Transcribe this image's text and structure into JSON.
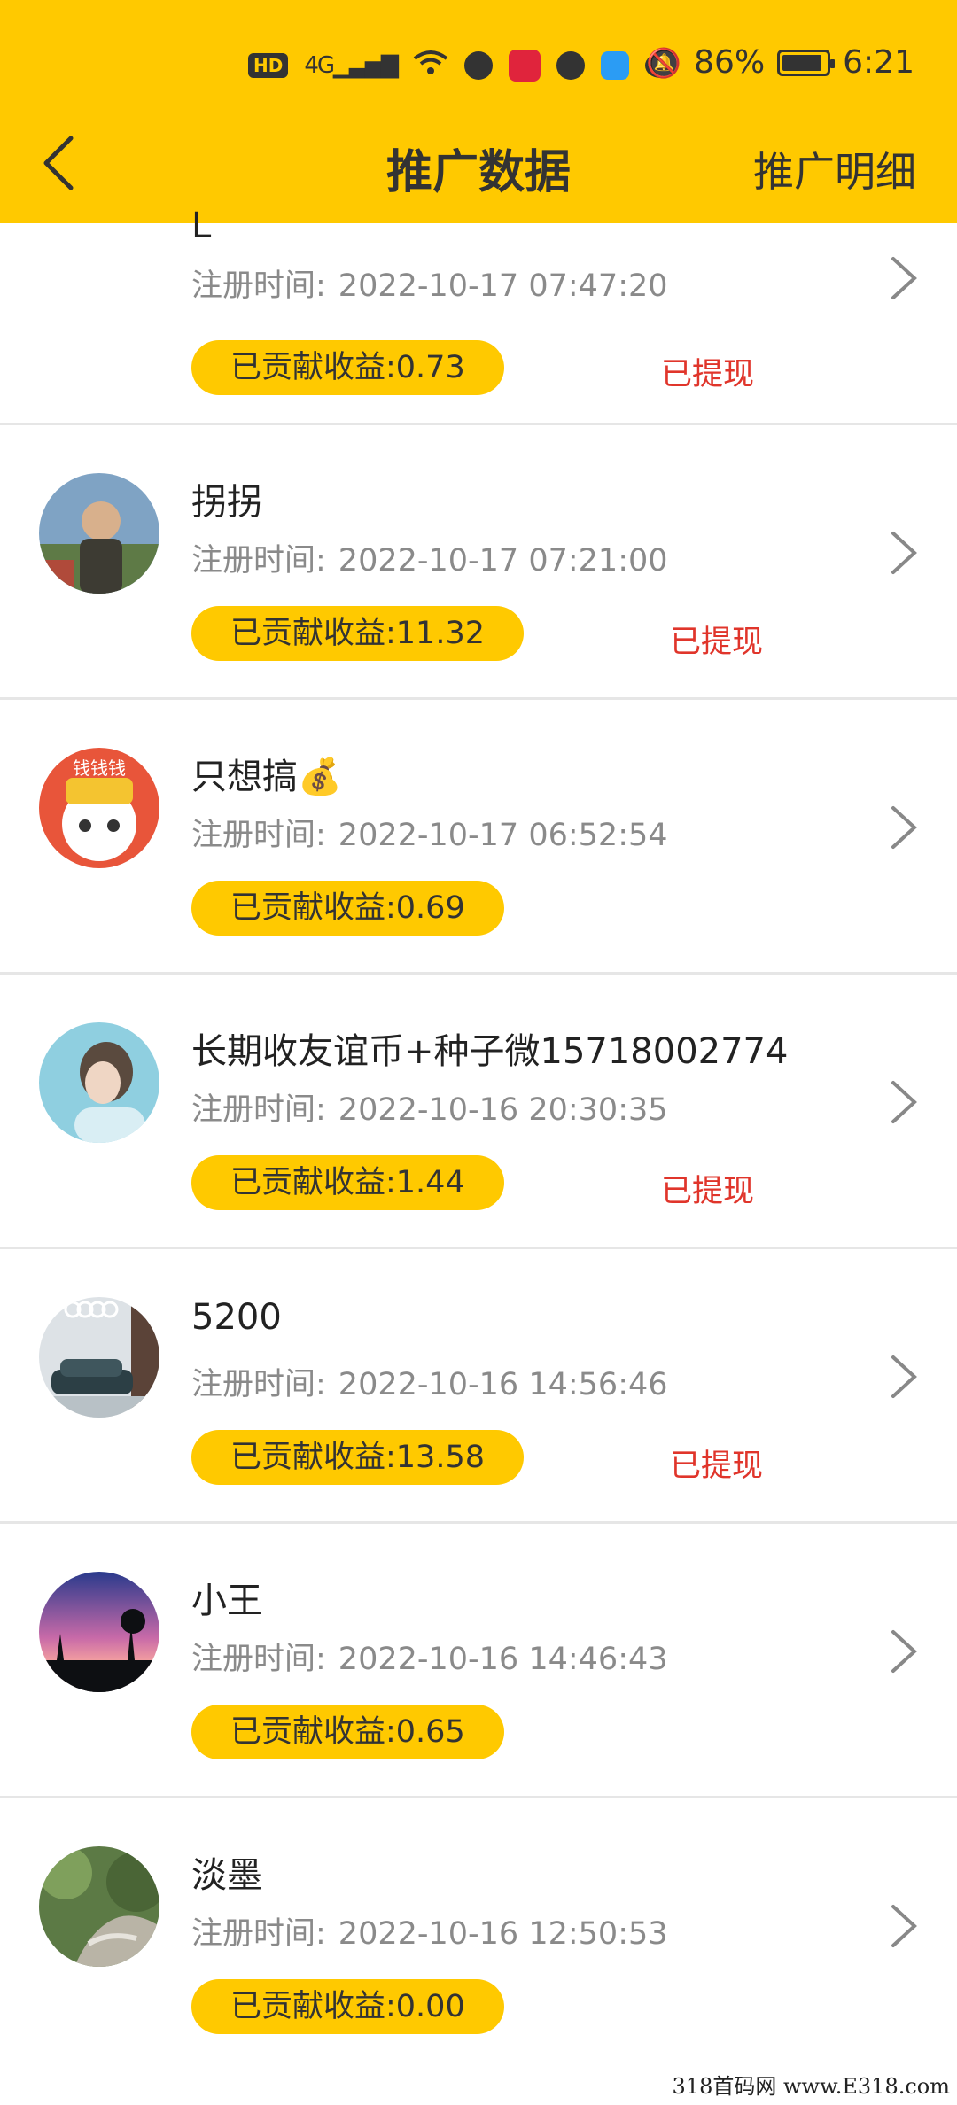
{
  "status_bar": {
    "battery": "86%",
    "time": "6:21",
    "icons": [
      "hd-icon",
      "4g-signal-icon",
      "wifi-icon",
      "qq-icon",
      "app-icon",
      "browser-icon",
      "cloud-icon",
      "chat-icon"
    ]
  },
  "nav": {
    "title": "推广数据",
    "detail_link": "推广明细"
  },
  "labels": {
    "register_prefix": "注册时间:"
  },
  "rows": [
    {
      "name": "L",
      "time": "2022-10-17 07:47:20",
      "earn": "已贡献收益:0.73",
      "status": "已提现"
    },
    {
      "name": "拐拐",
      "time": "2022-10-17 07:21:00",
      "earn": "已贡献收益:11.32",
      "status": "已提现"
    },
    {
      "name": "只想搞💰",
      "time": "2022-10-17 06:52:54",
      "earn": "已贡献收益:0.69",
      "status": ""
    },
    {
      "name": "长期收友谊币+种子微15718002774",
      "time": "2022-10-16 20:30:35",
      "earn": "已贡献收益:1.44",
      "status": "已提现"
    },
    {
      "name": "5200",
      "time": "2022-10-16 14:56:46",
      "earn": "已贡献收益:13.58",
      "status": "已提现"
    },
    {
      "name": "小王",
      "time": "2022-10-16 14:46:43",
      "earn": "已贡献收益:0.65",
      "status": ""
    },
    {
      "name": "淡墨",
      "time": "2022-10-16 12:50:53",
      "earn": "已贡献收益:0.00",
      "status": ""
    }
  ],
  "watermark": "318首码网 www.E318.com",
  "colors": {
    "accent": "#FFC900",
    "withdrawn": "#e0352b"
  }
}
